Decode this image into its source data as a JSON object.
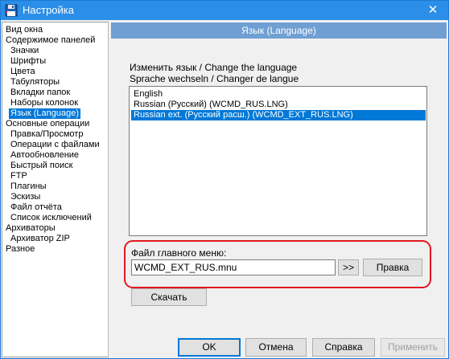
{
  "window": {
    "title": "Настройка"
  },
  "tree": {
    "items": [
      {
        "label": "Вид окна",
        "indent": 0
      },
      {
        "label": "Содержимое панелей",
        "indent": 0
      },
      {
        "label": "Значки",
        "indent": 1
      },
      {
        "label": "Шрифты",
        "indent": 1
      },
      {
        "label": "Цвета",
        "indent": 1
      },
      {
        "label": "Табуляторы",
        "indent": 1
      },
      {
        "label": "Вкладки папок",
        "indent": 1
      },
      {
        "label": "Наборы колонок",
        "indent": 1
      },
      {
        "label": "Язык (Language)",
        "indent": 1,
        "selected": true
      },
      {
        "label": "Основные операции",
        "indent": 0
      },
      {
        "label": "Правка/Просмотр",
        "indent": 1
      },
      {
        "label": "Операции с файлами",
        "indent": 1
      },
      {
        "label": "Автообновление",
        "indent": 1
      },
      {
        "label": "Быстрый поиск",
        "indent": 1
      },
      {
        "label": "FTP",
        "indent": 1
      },
      {
        "label": "Плагины",
        "indent": 1
      },
      {
        "label": "Эскизы",
        "indent": 1
      },
      {
        "label": "Файл отчёта",
        "indent": 1
      },
      {
        "label": "Список исключений",
        "indent": 1
      },
      {
        "label": "Архиваторы",
        "indent": 0
      },
      {
        "label": "Архиватор ZIP",
        "indent": 1
      },
      {
        "label": "Разное",
        "indent": 0
      }
    ]
  },
  "panel": {
    "header": "Язык (Language)",
    "change_language_line1": "Изменить язык / Change the language",
    "change_language_line2": "Sprache wechseln / Changer de langue",
    "languages": [
      {
        "label": "English",
        "selected": false
      },
      {
        "label": "Russian (Русский) (WCMD_RUS.LNG)",
        "selected": false
      },
      {
        "label": "Russian ext. (Русский расш.) (WCMD_EXT_RUS.LNG)",
        "selected": true
      }
    ],
    "menu_file_label": "Файл главного меню:",
    "menu_file_value": "WCMD_EXT_RUS.mnu",
    "browse_label": ">>",
    "edit_label": "Правка",
    "download_label": "Скачать"
  },
  "buttons": {
    "ok": "OK",
    "cancel": "Отмена",
    "help": "Справка",
    "apply": "Применить"
  },
  "colors": {
    "titlebar": "#2b8ee8",
    "selection": "#0078d7",
    "header": "#6f9fd3",
    "highlight_ring": "#e0181e"
  },
  "icons": {
    "app": "floppy-disk-icon",
    "close": "close-icon"
  }
}
